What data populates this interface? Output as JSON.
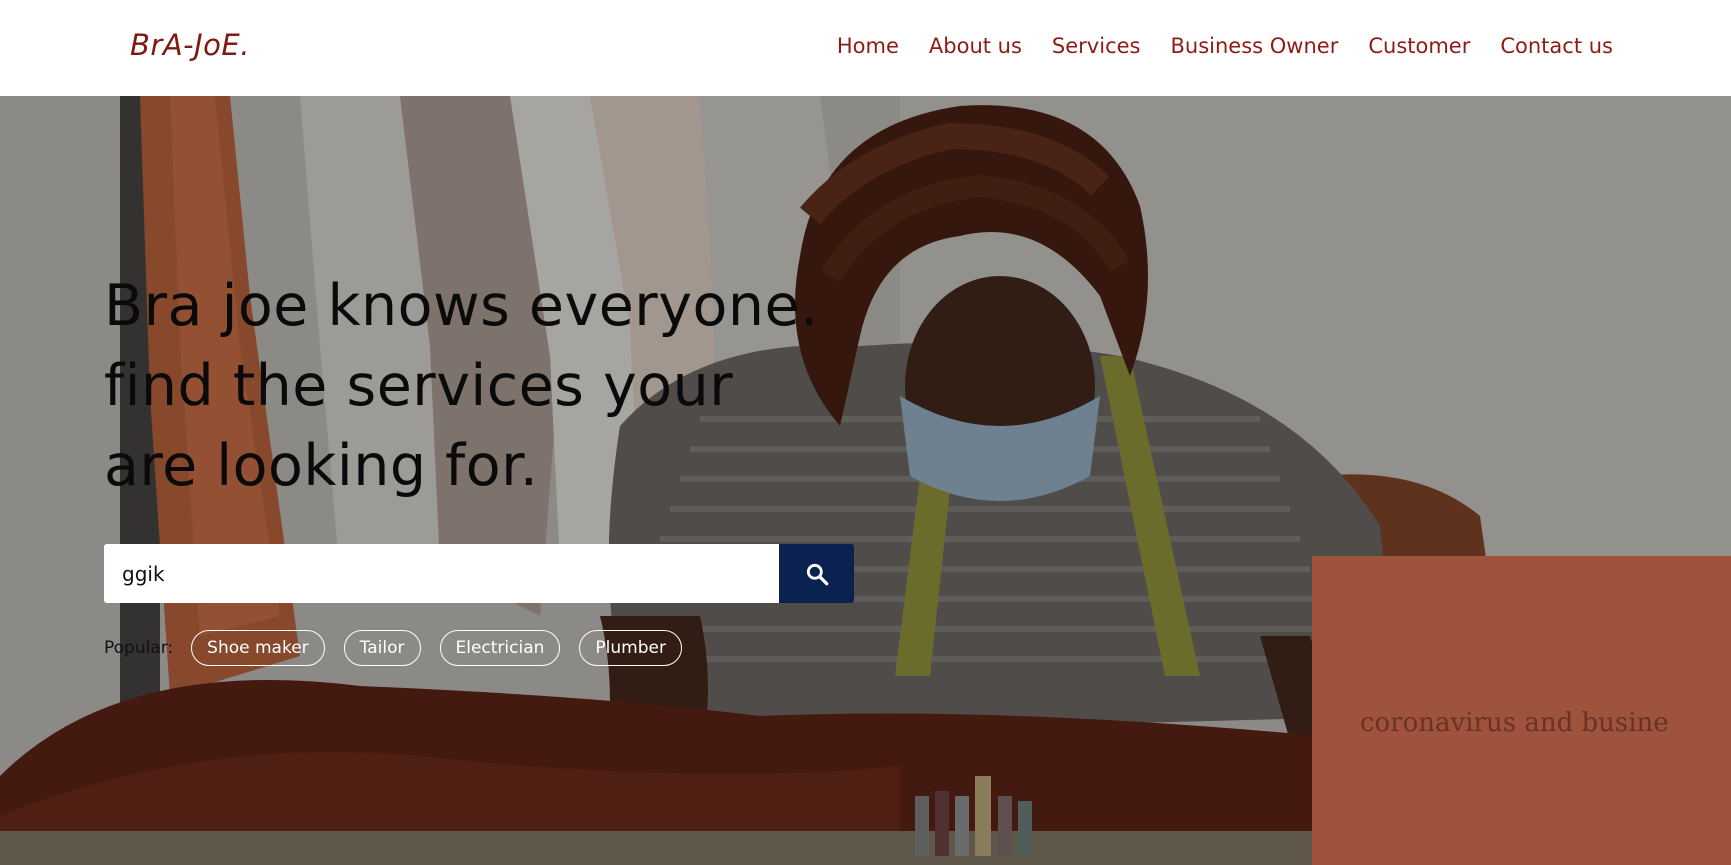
{
  "brand": {
    "logo_text": "BrA-JoE."
  },
  "nav": {
    "items": [
      {
        "label": "Home"
      },
      {
        "label": "About us"
      },
      {
        "label": "Services"
      },
      {
        "label": "Business Owner"
      },
      {
        "label": "Customer"
      },
      {
        "label": "Contact us"
      }
    ]
  },
  "hero": {
    "headline_lines": [
      "Bra joe knows everyone.",
      "find the services your",
      "are looking for."
    ],
    "background_text": "coronavirus and busine",
    "search": {
      "value": "ggik",
      "placeholder": ""
    },
    "popular_label": "Popular:",
    "popular_tags": [
      {
        "label": "Shoe maker"
      },
      {
        "label": "Tailor"
      },
      {
        "label": "Electrician"
      },
      {
        "label": "Plumber"
      }
    ]
  },
  "colors": {
    "brand": "#7d1b12",
    "nav_link": "#8c1d15",
    "search_button": "#0b2150",
    "overlay": "#000000"
  },
  "icons": {
    "search": "search-icon"
  }
}
